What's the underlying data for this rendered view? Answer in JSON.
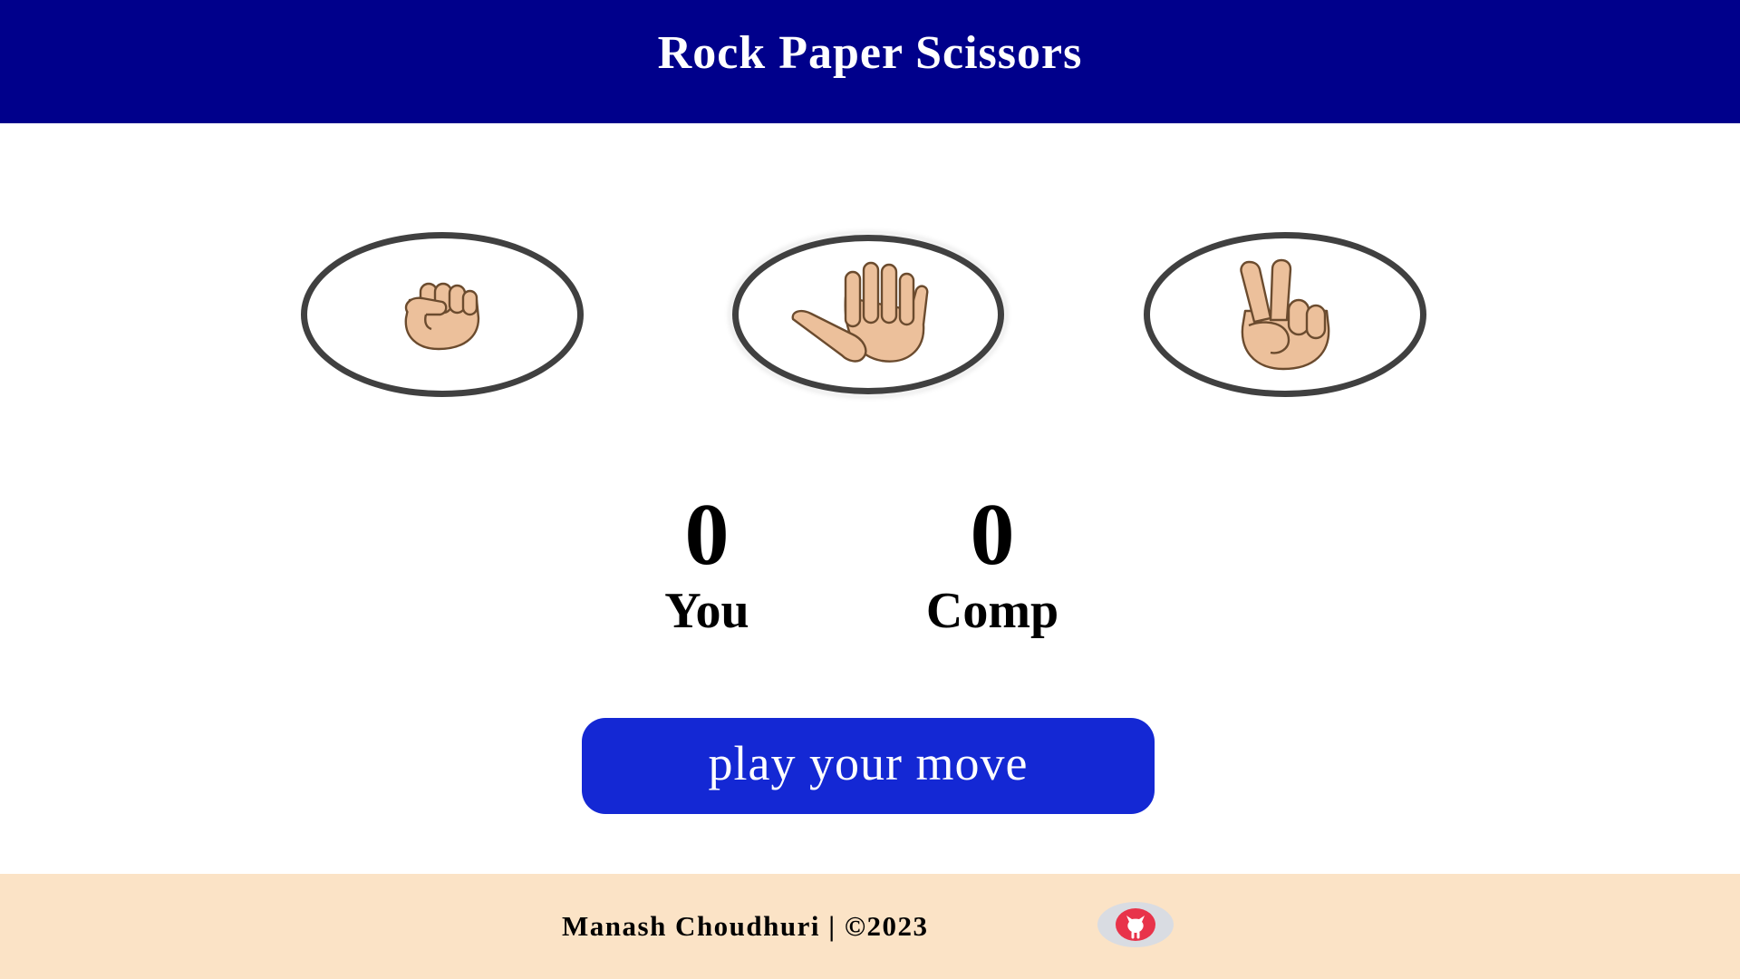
{
  "header": {
    "title": "Rock Paper Scissors",
    "background": "#00008b"
  },
  "choices": [
    {
      "id": "rock",
      "icon": "fist-icon"
    },
    {
      "id": "paper",
      "icon": "open-hand-icon"
    },
    {
      "id": "scissors",
      "icon": "victory-hand-icon"
    }
  ],
  "scoreboard": {
    "user_score": "0",
    "user_label": "You",
    "comp_score": "0",
    "comp_label": "Comp"
  },
  "message": {
    "label": "play your move",
    "background": "#1428d4"
  },
  "footer": {
    "text": "Manash Choudhuri | ©2023",
    "background": "#fbe3c6",
    "github_icon": "github-icon",
    "github_color": "#e8334a"
  }
}
